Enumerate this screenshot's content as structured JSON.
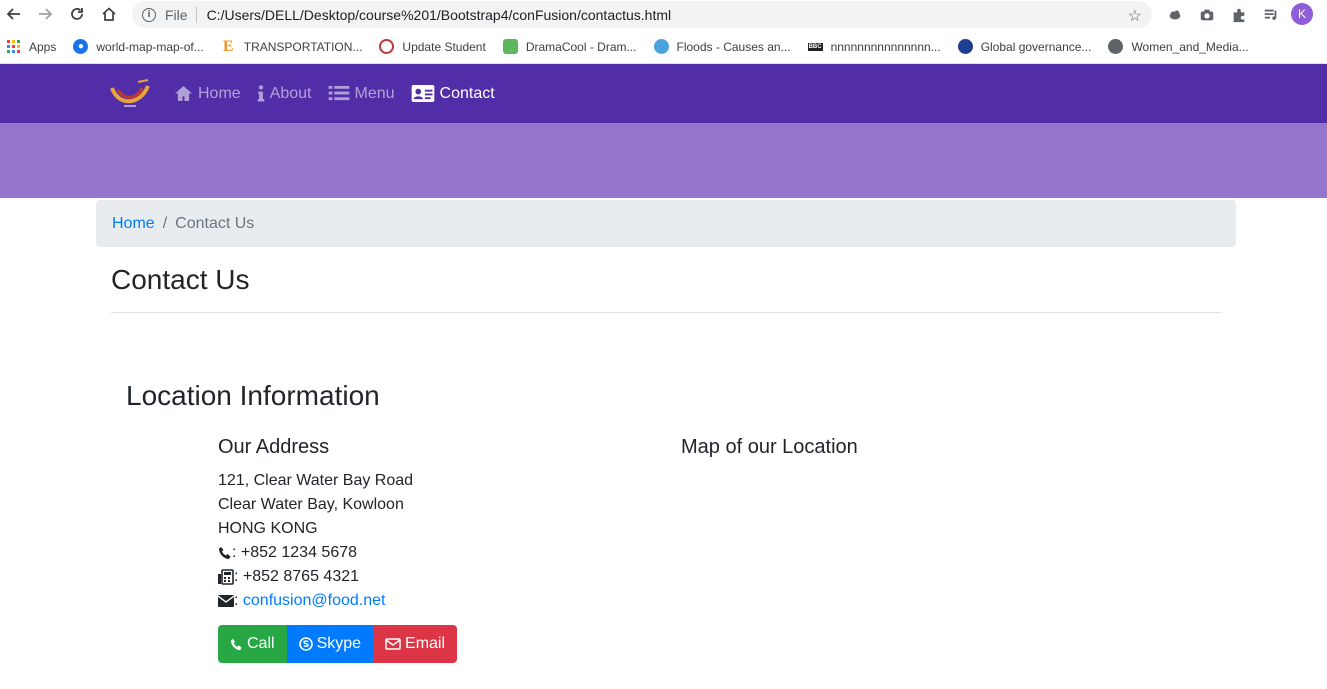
{
  "browser": {
    "scheme_label": "File",
    "url": "C:/Users/DELL/Desktop/course%201/Bootstrap4/conFusion/contactus.html",
    "profile_initial": "K",
    "bookmarks": [
      {
        "label": "Apps",
        "icon": "apps-grid-icon"
      },
      {
        "label": "world-map-map-of...",
        "icon": "globe-icon"
      },
      {
        "label": "TRANSPORTATION...",
        "icon": "e-logo-icon"
      },
      {
        "label": "Update Student",
        "icon": "seal-icon"
      },
      {
        "label": "DramaCool - Dram...",
        "icon": "dramacool-icon"
      },
      {
        "label": "Floods - Causes an...",
        "icon": "globe-icon"
      },
      {
        "label": "nnnnnnnnnnnnnnn...",
        "icon": "bbc-icon"
      },
      {
        "label": "Global governance...",
        "icon": "emblem-icon"
      },
      {
        "label": "Women_and_Media...",
        "icon": "world-icon"
      }
    ]
  },
  "navbar": {
    "items": [
      {
        "label": "Home",
        "icon": "home-icon",
        "active": false
      },
      {
        "label": "About",
        "icon": "info-icon",
        "active": false
      },
      {
        "label": "Menu",
        "icon": "list-icon",
        "active": false
      },
      {
        "label": "Contact",
        "icon": "address-card-icon",
        "active": true
      }
    ]
  },
  "breadcrumb": {
    "home": "Home",
    "separator": "/",
    "current": "Contact Us"
  },
  "page": {
    "title": "Contact Us",
    "section_title": "Location Information",
    "address_heading": "Our Address",
    "map_heading": "Map of our Location",
    "address_lines": [
      "121, Clear Water Bay Road",
      "Clear Water Bay, Kowloon",
      "HONG KONG"
    ],
    "phone": ": +852 1234 5678",
    "fax": ": +852 8765 4321",
    "email_prefix": ": ",
    "email": "confusion@food.net"
  },
  "buttons": {
    "call": "Call",
    "skype": "Skype",
    "email": "Email"
  },
  "colors": {
    "navbar": "#512da8",
    "jumbotron": "#9575cd",
    "link": "#007bff",
    "call": "#28a745",
    "skype": "#007bff",
    "email": "#dc3545"
  }
}
